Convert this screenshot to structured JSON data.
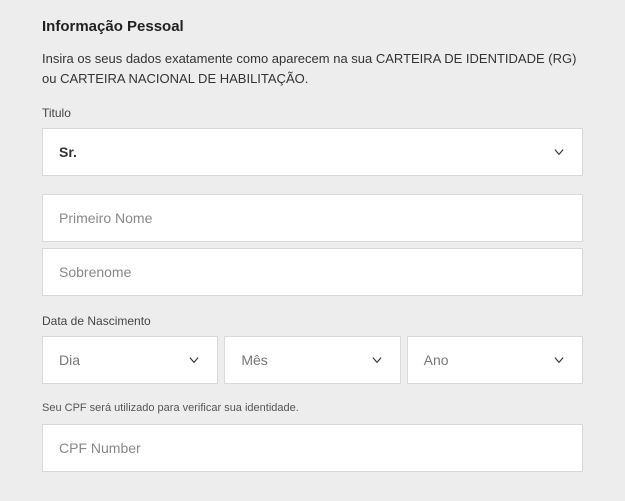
{
  "heading": "Informação Pessoal",
  "description": "Insira os seus dados exatamente como aparecem na sua CARTEIRA DE IDENTIDADE (RG) ou CARTEIRA NACIONAL DE HABILITAÇÃO.",
  "title": {
    "label": "Titulo",
    "value": "Sr."
  },
  "first_name": {
    "placeholder": "Primeiro Nome",
    "value": ""
  },
  "last_name": {
    "placeholder": "Sobrenome",
    "value": ""
  },
  "dob": {
    "label": "Data de Nascimento",
    "day": "Dia",
    "month": "Mês",
    "year": "Ano"
  },
  "cpf": {
    "helper": "Seu CPF será utilizado para verificar sua identidade.",
    "placeholder": "CPF Number",
    "value": ""
  }
}
